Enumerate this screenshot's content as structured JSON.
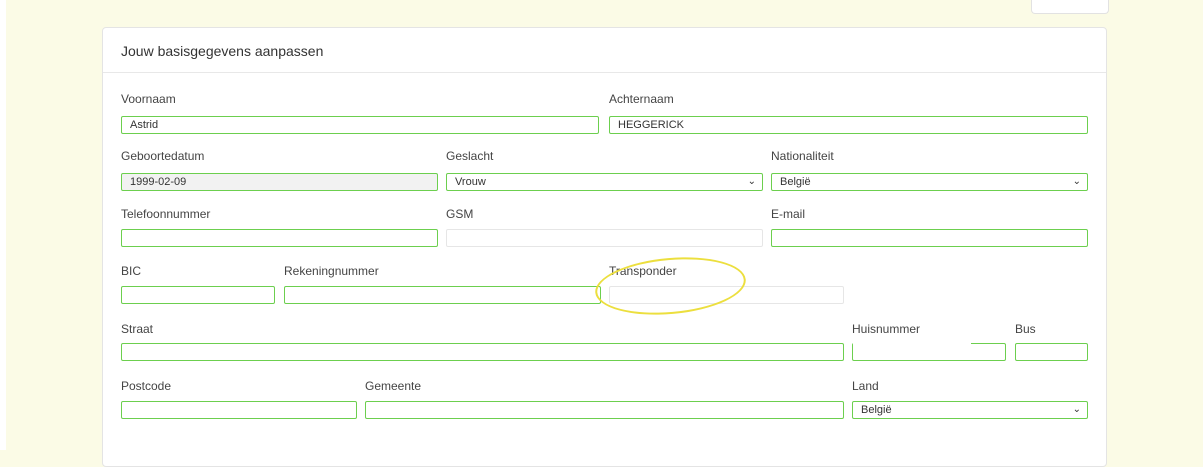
{
  "card": {
    "title": "Jouw basisgegevens aanpassen"
  },
  "fields": {
    "voornaam": {
      "label": "Voornaam",
      "value": "Astrid"
    },
    "achternaam": {
      "label": "Achternaam",
      "value": "HEGGERICK"
    },
    "geboortedatum": {
      "label": "Geboortedatum",
      "value": "1999-02-09"
    },
    "geslacht": {
      "label": "Geslacht",
      "value": "Vrouw"
    },
    "nationaliteit": {
      "label": "Nationaliteit",
      "value": "België"
    },
    "telefoonnummer": {
      "label": "Telefoonnummer",
      "value": ""
    },
    "gsm": {
      "label": "GSM",
      "value": ""
    },
    "email": {
      "label": "E-mail",
      "value": ""
    },
    "bic": {
      "label": "BIC",
      "value": ""
    },
    "rekeningnummer": {
      "label": "Rekeningnummer",
      "value": ""
    },
    "transponder": {
      "label": "Transponder",
      "value": ""
    },
    "straat": {
      "label": "Straat",
      "value": ""
    },
    "huisnummer": {
      "label": "Huisnummer",
      "value": ""
    },
    "bus": {
      "label": "Bus",
      "value": ""
    },
    "postcode": {
      "label": "Postcode",
      "value": ""
    },
    "gemeente": {
      "label": "Gemeente",
      "value": ""
    },
    "land": {
      "label": "Land",
      "value": "België"
    }
  },
  "icons": {
    "dropdown": "chevron-down-icon"
  },
  "colors": {
    "input_border": "#6ccf4e",
    "highlight": "#ecdf3e",
    "background": "#fbfbe6"
  }
}
